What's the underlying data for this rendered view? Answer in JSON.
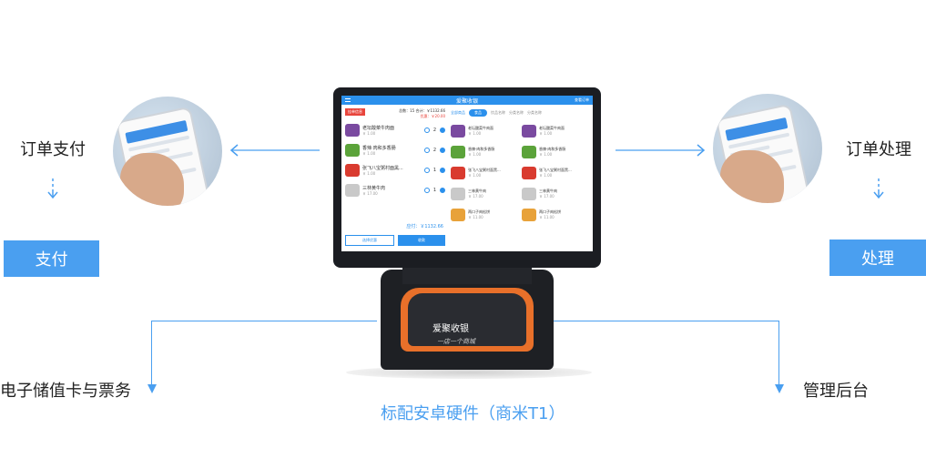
{
  "left": {
    "title": "订单支付",
    "button": "支付",
    "bottom_label": "电子储值卡与票务"
  },
  "right": {
    "title": "订单处理",
    "button": "处理",
    "bottom_label": "管理后台"
  },
  "device": {
    "caption": "标配安卓硬件（商米T1）",
    "brand": "爱聚收银",
    "brand_sub": "一店一个商城",
    "screen": {
      "app_title": "爱聚收银",
      "top_right": "查看订单",
      "order_tag": "挂单信息",
      "count_label": "总数：15",
      "total_label": "合计：￥1132.66",
      "discount_label": "优惠：￥20.00",
      "payable_label": "应付：￥1132.66",
      "btn_choose": "选择优惠",
      "btn_pay": "收款",
      "order_items": [
        {
          "name": "老坛酸菜牛肉面",
          "price": "￥ 1.00",
          "qty": "2",
          "color": "#7a4aa0"
        },
        {
          "name": "香辣·肉和多香肠",
          "price": "￥ 1.00",
          "qty": "2",
          "color": "#5ba33a"
        },
        {
          "name": "张飞八宝粥村面黑...",
          "price": "￥ 1.00",
          "qty": "1",
          "color": "#d93b2f"
        },
        {
          "name": "三林黄牛肉",
          "price": "￥ 17.00",
          "qty": "1",
          "color": "#c9c9c9"
        }
      ],
      "tabs": [
        "全部商品",
        "食品",
        "饮品名称",
        "分类名称",
        "分类名称"
      ],
      "active_tab": "食品",
      "products": [
        {
          "name": "老坛酸菜牛肉面",
          "price": "￥ 1.00",
          "color": "#7a4aa0"
        },
        {
          "name": "老坛酸菜牛肉面",
          "price": "￥ 1.00",
          "color": "#7a4aa0"
        },
        {
          "name": "香辣·肉和多香肠",
          "price": "￥ 1.00",
          "color": "#5ba33a"
        },
        {
          "name": "香辣·肉和多香肠",
          "price": "￥ 1.00",
          "color": "#5ba33a"
        },
        {
          "name": "张飞八宝粥村面黑...",
          "price": "￥ 1.00",
          "color": "#d93b2f"
        },
        {
          "name": "张飞八宝粥村面黑...",
          "price": "￥ 1.00",
          "color": "#d93b2f"
        },
        {
          "name": "三林黄牛肉",
          "price": "￥ 17.00",
          "color": "#c9c9c9"
        },
        {
          "name": "三林黄牛肉",
          "price": "￥ 17.00",
          "color": "#c9c9c9"
        },
        {
          "name": "两口子肉松饼",
          "price": "￥ 11.00",
          "color": "#e8a23a"
        },
        {
          "name": "两口子肉松饼",
          "price": "￥ 11.00",
          "color": "#e8a23a"
        }
      ]
    }
  },
  "accent_color": "#4a9ff0"
}
